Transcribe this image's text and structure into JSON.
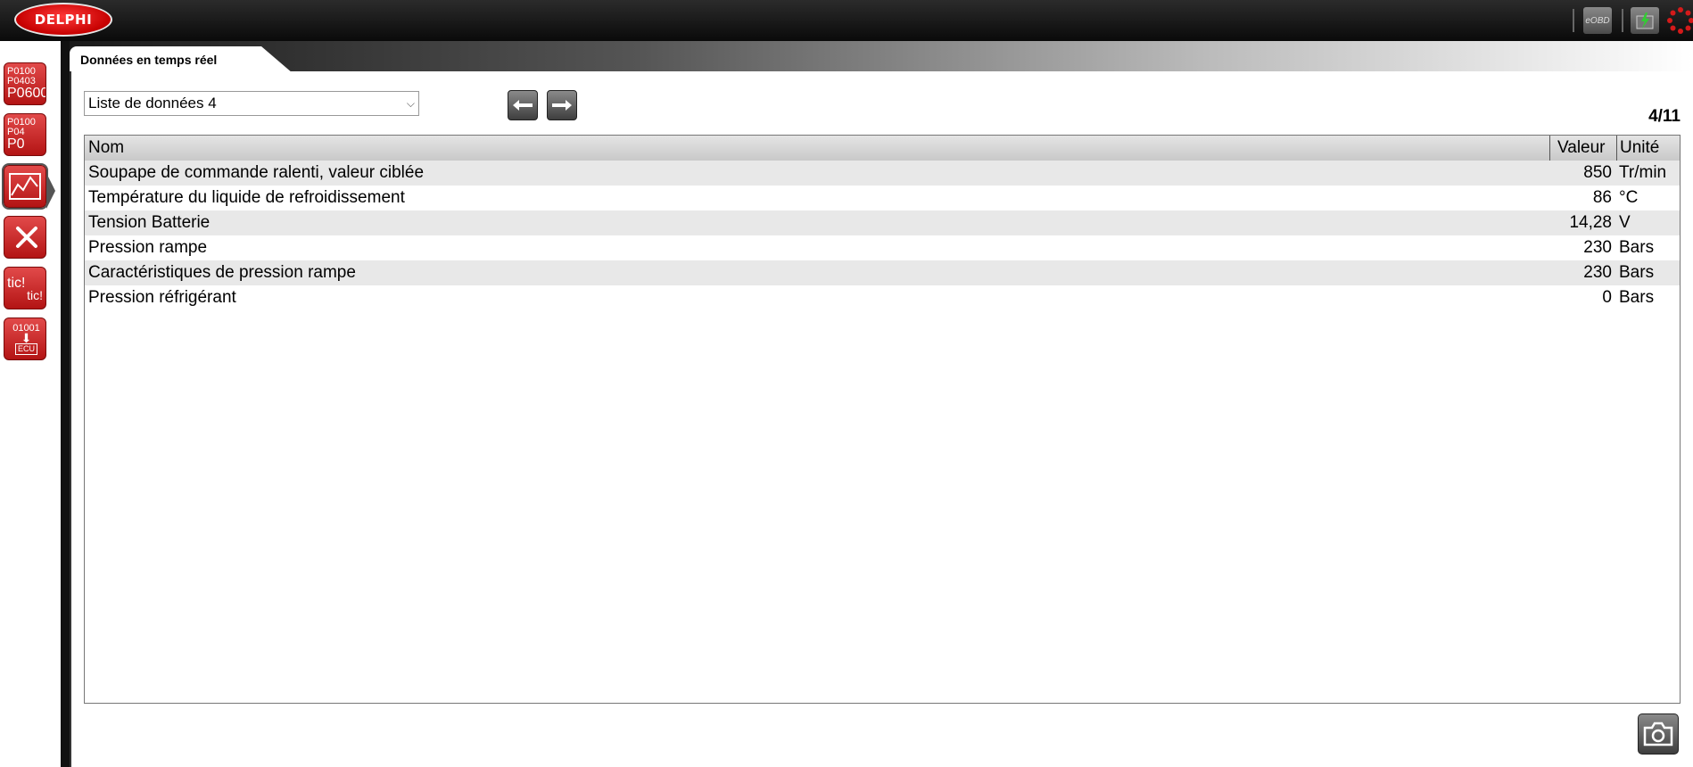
{
  "topbar": {
    "logo_text": "DELPHI",
    "eobd_label": "eOBD",
    "icons": [
      "eobd-icon",
      "battery-charge-icon",
      "busy-spinner-icon"
    ]
  },
  "sidebar": {
    "items": [
      {
        "icon": "fault-codes-icon",
        "lines": [
          "P0100",
          "P0403",
          "P0600"
        ]
      },
      {
        "icon": "clear-fault-codes-icon",
        "lines": [
          "P0100",
          "P04",
          "P0"
        ]
      },
      {
        "icon": "live-data-icon",
        "active": true
      },
      {
        "icon": "actuator-test-icon"
      },
      {
        "icon": "tic-tic-icon",
        "lines": [
          "tic!",
          "tic!"
        ]
      },
      {
        "icon": "ecu-download-icon",
        "lines": [
          "01001",
          "ECU"
        ]
      }
    ]
  },
  "tab": {
    "label": "Données en temps réel"
  },
  "toolbar": {
    "list_select_value": "Liste de données 4",
    "prev_icon": "arrow-left-icon",
    "next_icon": "arrow-right-icon",
    "page_count": "4/11"
  },
  "table": {
    "headers": {
      "name": "Nom",
      "value": "Valeur",
      "unit": "Unité"
    },
    "rows": [
      {
        "name": "Soupape de commande ralenti, valeur ciblée",
        "value": "850",
        "unit": "Tr/min"
      },
      {
        "name": "Température du liquide de refroidissement",
        "value": "86",
        "unit": "°C"
      },
      {
        "name": "Tension Batterie",
        "value": "14,28",
        "unit": "V"
      },
      {
        "name": "Pression rampe",
        "value": "230",
        "unit": "Bars"
      },
      {
        "name": "Caractéristiques de pression rampe",
        "value": "230",
        "unit": "Bars"
      },
      {
        "name": "Pression réfrigérant",
        "value": "0",
        "unit": "Bars"
      }
    ]
  },
  "footer": {
    "camera_icon": "camera-icon"
  },
  "colors": {
    "brand_red": "#c60000",
    "row_alt": "#e8e8e8",
    "header_gray": "#d0d0d0"
  }
}
